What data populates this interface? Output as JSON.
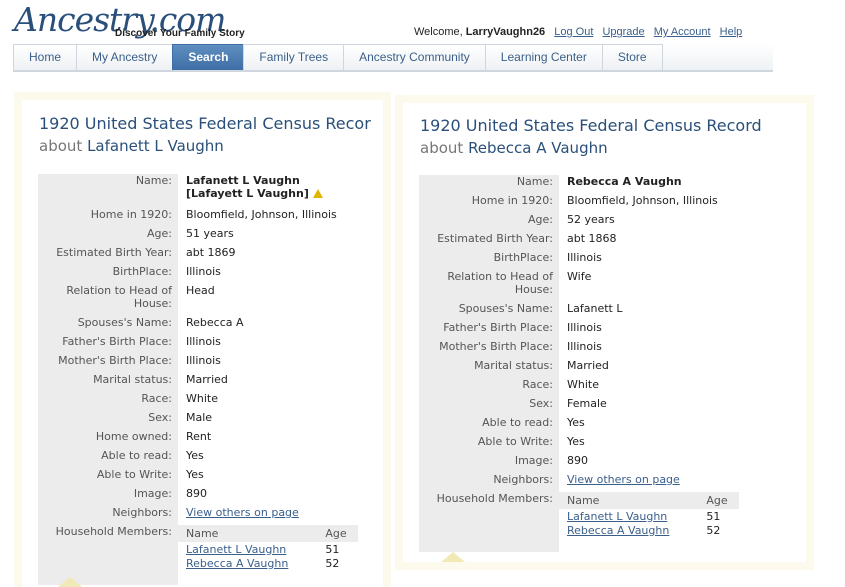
{
  "header": {
    "logo": "Ancestry.com",
    "tagline": "Discover Your Family Story",
    "welcome": "Welcome,",
    "username": "LarryVaughn26",
    "links": [
      "Log Out",
      "Upgrade",
      "My Account",
      "Help"
    ]
  },
  "nav": {
    "tabs": [
      "Home",
      "My Ancestry",
      "Search",
      "Family Trees",
      "Ancestry Community",
      "Learning Center",
      "Store"
    ],
    "active": "Search"
  },
  "left_record": {
    "title": "1920 United States Federal Census Recor",
    "about_prefix": "about",
    "about_name": "Lafanett L Vaughn",
    "fields": {
      "name_label": "Name:",
      "name": "Lafanett L Vaughn",
      "name_alt": "[Lafayett L Vaughn]",
      "home_label": "Home in 1920:",
      "home": "Bloomfield, Johnson, Illinois",
      "age_label": "Age:",
      "age": "51 years",
      "birth_year_label": "Estimated Birth Year:",
      "birth_year": "abt 1869",
      "birthplace_label": "BirthPlace:",
      "birthplace": "Illinois",
      "relation_label": "Relation to Head of House:",
      "relation": "Head",
      "spouse_label": "Spouses's Name:",
      "spouse": "Rebecca A",
      "father_label": "Father's Birth Place:",
      "father": "Illinois",
      "mother_label": "Mother's Birth Place:",
      "mother": "Illinois",
      "marital_label": "Marital status:",
      "marital": "Married",
      "race_label": "Race:",
      "race": "White",
      "sex_label": "Sex:",
      "sex": "Male",
      "home_owned_label": "Home owned:",
      "home_owned": "Rent",
      "read_label": "Able to read:",
      "read": "Yes",
      "write_label": "Able to Write:",
      "write": "Yes",
      "image_label": "Image:",
      "image": "890",
      "neighbors_label": "Neighbors:",
      "neighbors": "View others on page",
      "household_label": "Household Members:"
    },
    "household": {
      "col_name": "Name",
      "col_age": "Age",
      "rows": [
        {
          "name": "Lafanett L Vaughn",
          "age": "51"
        },
        {
          "name": "Rebecca A Vaughn",
          "age": "52"
        }
      ]
    }
  },
  "right_record": {
    "title": "1920 United States Federal Census Record",
    "about_prefix": "about",
    "about_name": "Rebecca A Vaughn",
    "fields": {
      "name_label": "Name:",
      "name": "Rebecca A Vaughn",
      "home_label": "Home in 1920:",
      "home": "Bloomfield, Johnson, Illinois",
      "age_label": "Age:",
      "age": "52 years",
      "birth_year_label": "Estimated Birth Year:",
      "birth_year": "abt 1868",
      "birthplace_label": "BirthPlace:",
      "birthplace": "Illinois",
      "relation_label": "Relation to Head of House:",
      "relation": "Wife",
      "spouse_label": "Spouses's Name:",
      "spouse": "Lafanett L",
      "father_label": "Father's Birth Place:",
      "father": "Illinois",
      "mother_label": "Mother's Birth Place:",
      "mother": "Illinois",
      "marital_label": "Marital status:",
      "marital": "Married",
      "race_label": "Race:",
      "race": "White",
      "sex_label": "Sex:",
      "sex": "Female",
      "read_label": "Able to read:",
      "read": "Yes",
      "write_label": "Able to Write:",
      "write": "Yes",
      "image_label": "Image:",
      "image": "890",
      "neighbors_label": "Neighbors:",
      "neighbors": "View others on page",
      "household_label": "Household Members:"
    },
    "household": {
      "col_name": "Name",
      "col_age": "Age",
      "rows": [
        {
          "name": "Lafanett L Vaughn",
          "age": "51"
        },
        {
          "name": "Rebecca A Vaughn",
          "age": "52"
        }
      ]
    }
  }
}
